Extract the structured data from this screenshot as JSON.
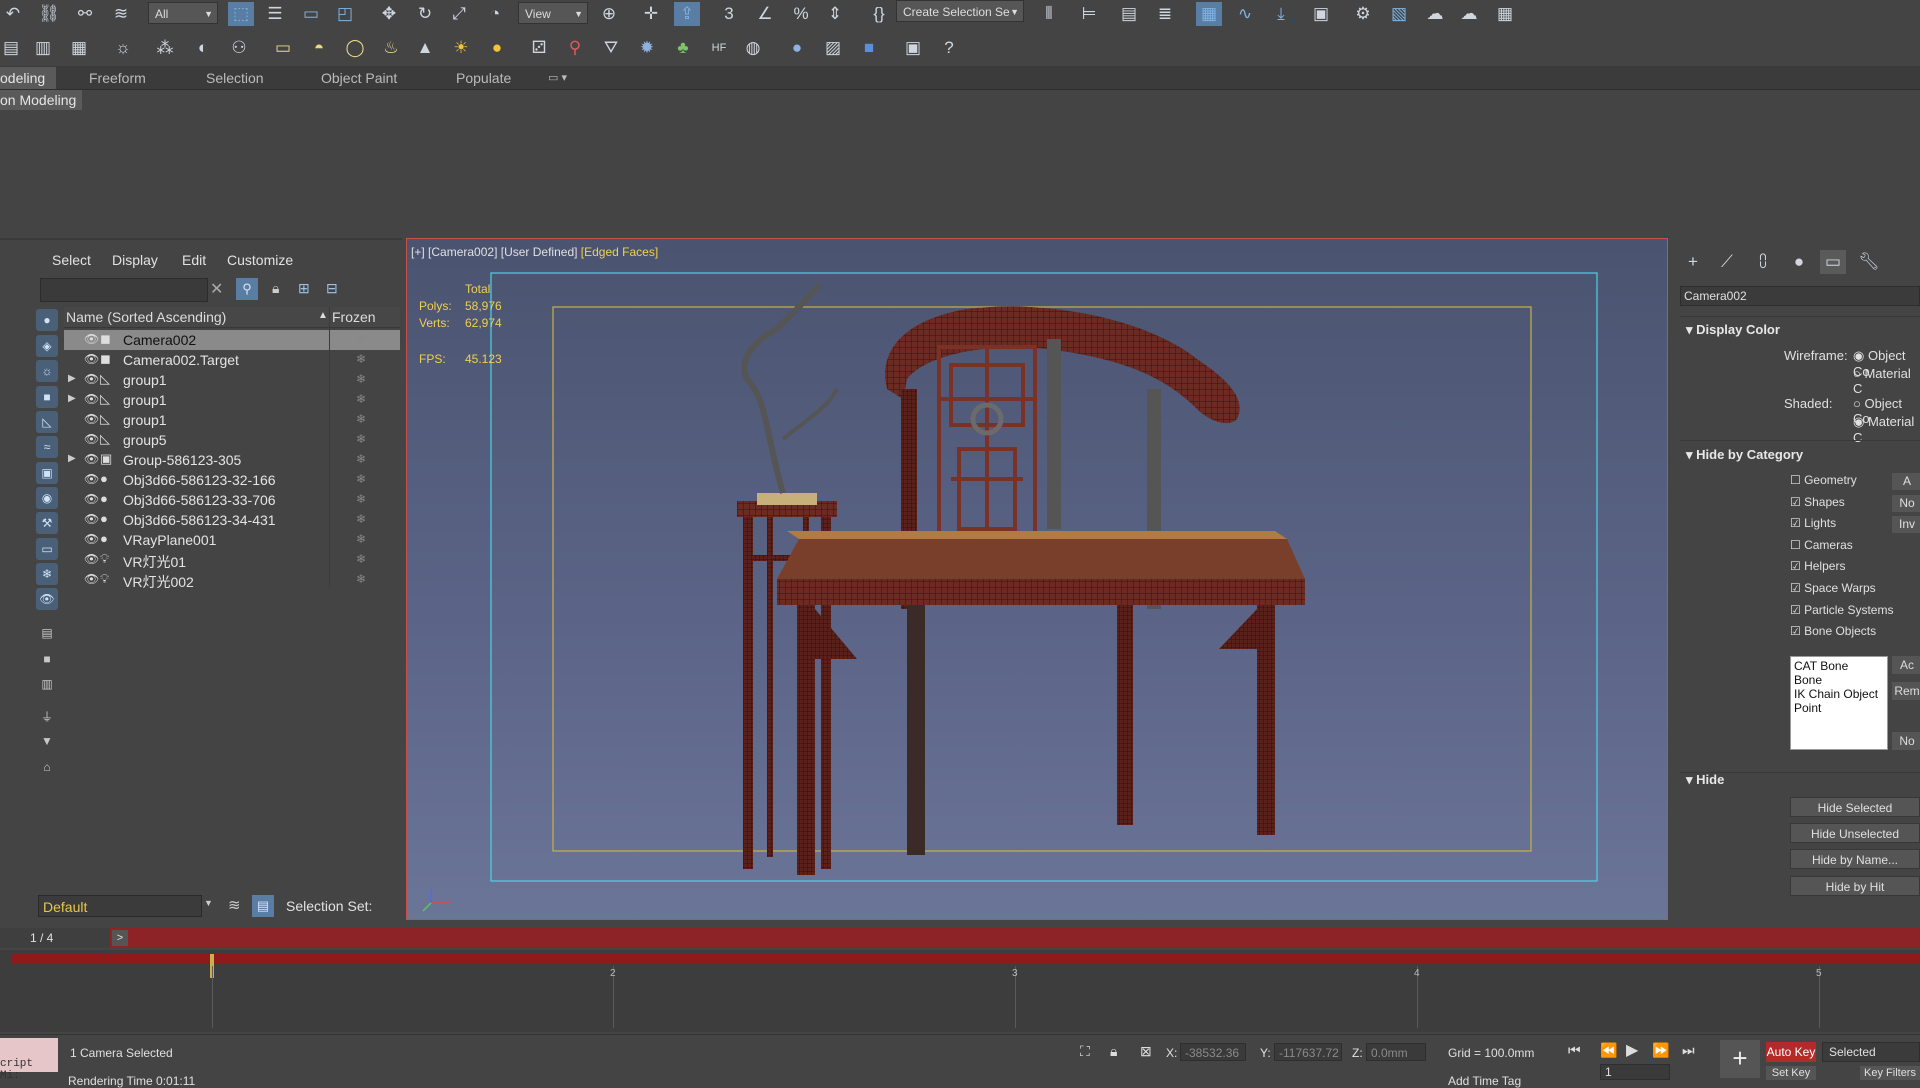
{
  "toolbar": {
    "filter_dropdown": "All",
    "view_dropdown": "View",
    "selection_set_dropdown": "Create Selection Se"
  },
  "ribbon": {
    "tabs": [
      "odeling",
      "Freeform",
      "Selection",
      "Object Paint",
      "Populate"
    ],
    "sub_label": "on Modeling"
  },
  "explorer": {
    "menus": [
      "Select",
      "Display",
      "Edit",
      "Customize"
    ],
    "column_name": "Name (Sorted Ascending)",
    "column_frozen": "Frozen",
    "rows": [
      {
        "name": "Camera002",
        "icon": "camera-icon",
        "selected": true,
        "expandable": false
      },
      {
        "name": "Camera002.Target",
        "icon": "camera-icon",
        "selected": false,
        "expandable": false
      },
      {
        "name": "group1",
        "icon": "helper-icon",
        "selected": false,
        "expandable": true
      },
      {
        "name": "group1",
        "icon": "helper-icon",
        "selected": false,
        "expandable": true
      },
      {
        "name": "group1",
        "icon": "helper-icon",
        "selected": false,
        "expandable": false
      },
      {
        "name": "group5",
        "icon": "helper-icon",
        "selected": false,
        "expandable": false
      },
      {
        "name": "Group-586123-305",
        "icon": "group-icon",
        "selected": false,
        "expandable": true
      },
      {
        "name": "Obj3d66-586123-32-166",
        "icon": "geometry-icon",
        "selected": false,
        "expandable": false
      },
      {
        "name": "Obj3d66-586123-33-706",
        "icon": "geometry-icon",
        "selected": false,
        "expandable": false
      },
      {
        "name": "Obj3d66-586123-34-431",
        "icon": "geometry-icon",
        "selected": false,
        "expandable": false
      },
      {
        "name": "VRayPlane001",
        "icon": "geometry-icon",
        "selected": false,
        "expandable": false
      },
      {
        "name": "VR灯光01",
        "icon": "light-icon",
        "selected": false,
        "expandable": false
      },
      {
        "name": "VR灯光002",
        "icon": "light-icon",
        "selected": false,
        "expandable": false
      }
    ],
    "layer_dropdown": "Default",
    "selection_set_label": "Selection Set:"
  },
  "viewport": {
    "label_plus": "[+]",
    "label_camera": "[Camera002]",
    "label_mode": "[User Defined]",
    "label_shading": "[Edged Faces]",
    "stats_total": "Total",
    "stats_polys_label": "Polys:",
    "stats_polys": "58,976",
    "stats_verts_label": "Verts:",
    "stats_verts": "62,974",
    "stats_fps_label": "FPS:",
    "stats_fps": "45.123"
  },
  "command_panel": {
    "object_name": "Camera002",
    "display_color": "Display Color",
    "wireframe_label": "Wireframe:",
    "wireframe_opt1": "Object Co",
    "wireframe_opt2": "Material C",
    "shaded_label": "Shaded:",
    "shaded_opt1": "Object Co",
    "shaded_opt2": "Material C",
    "hide_by_category": "Hide by Category",
    "categories": [
      {
        "label": "Geometry",
        "checked": false,
        "btn": "A"
      },
      {
        "label": "Shapes",
        "checked": true,
        "btn": "No"
      },
      {
        "label": "Lights",
        "checked": true,
        "btn": "Inv"
      },
      {
        "label": "Cameras",
        "checked": false,
        "btn": ""
      },
      {
        "label": "Helpers",
        "checked": true,
        "btn": ""
      },
      {
        "label": "Space Warps",
        "checked": true,
        "btn": ""
      },
      {
        "label": "Particle Systems",
        "checked": true,
        "btn": ""
      },
      {
        "label": "Bone Objects",
        "checked": true,
        "btn": ""
      }
    ],
    "bone_list": [
      "CAT Bone",
      "Bone",
      "IK Chain Object",
      "Point"
    ],
    "list_btns": [
      "Ac",
      "Rem",
      "No"
    ],
    "hide": "Hide",
    "hide_selected": "Hide Selected",
    "hide_unselected": "Hide Unselected",
    "hide_by_name": "Hide by Name...",
    "hide_by_hit": "Hide by Hit"
  },
  "timeline": {
    "frame_counter": "1 / 4",
    "next": ">",
    "ticks": [
      "2",
      "3",
      "4",
      "5"
    ]
  },
  "status": {
    "selected_text": "1 Camera Selected",
    "render_time": "Rendering Time 0:01:11",
    "script_box": "cript Mi:",
    "x_label": "X:",
    "x_value": "-38532.36",
    "y_label": "Y:",
    "y_value": "-117637.72",
    "z_label": "Z:",
    "z_value": "0.0mm",
    "grid": "Grid = 100.0mm",
    "add_time_tag": "Add Time Tag",
    "auto_key": "Auto Key",
    "set_key": "Set Key",
    "selected_dd": "Selected",
    "key_filters": "Key Filters",
    "frame_field": "1"
  }
}
